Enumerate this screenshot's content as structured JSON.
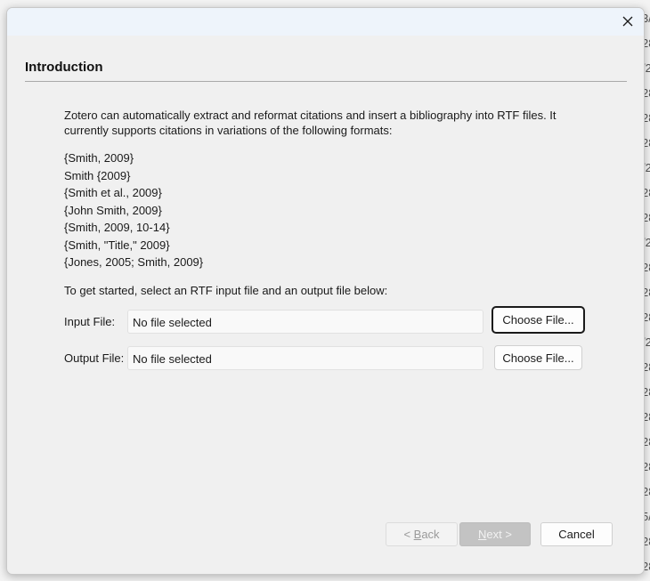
{
  "background": {
    "fragments": [
      "3/",
      "28",
      "/2",
      "28",
      "28",
      "28",
      "/2",
      "28",
      "28",
      "/2",
      "28",
      "28",
      "28",
      "/2",
      "28",
      "28",
      "28",
      "28",
      "28",
      "28",
      "5/",
      "28",
      "28",
      "/2"
    ]
  },
  "dialog": {
    "page_title": "Introduction",
    "intro_text": "Zotero can automatically extract and reformat citations and insert a bibliography into RTF files. It currently supports citations in variations of the following formats:",
    "formats": [
      "{Smith, 2009}",
      "Smith {2009}",
      "{Smith et al., 2009}",
      "{John Smith, 2009}",
      "{Smith, 2009, 10-14}",
      "{Smith, \"Title,\" 2009}",
      "{Jones, 2005; Smith, 2009}"
    ],
    "get_started_text": "To get started, select an RTF input file and an output file below:",
    "input_file": {
      "label": "Input File:",
      "value": "No file selected",
      "button": "Choose File..."
    },
    "output_file": {
      "label": "Output File:",
      "value": "No file selected",
      "button": "Choose File..."
    },
    "buttons": {
      "back_prefix": "< ",
      "back_accel": "B",
      "back_rest": "ack",
      "next_accel": "N",
      "next_rest": "ext >",
      "cancel": "Cancel"
    }
  },
  "icons": {
    "close": "close-icon"
  },
  "colors": {
    "titlebar": "#eef4fb",
    "dialog_bg": "#f0f0f0",
    "next_disabled": "#c3c3c3"
  }
}
